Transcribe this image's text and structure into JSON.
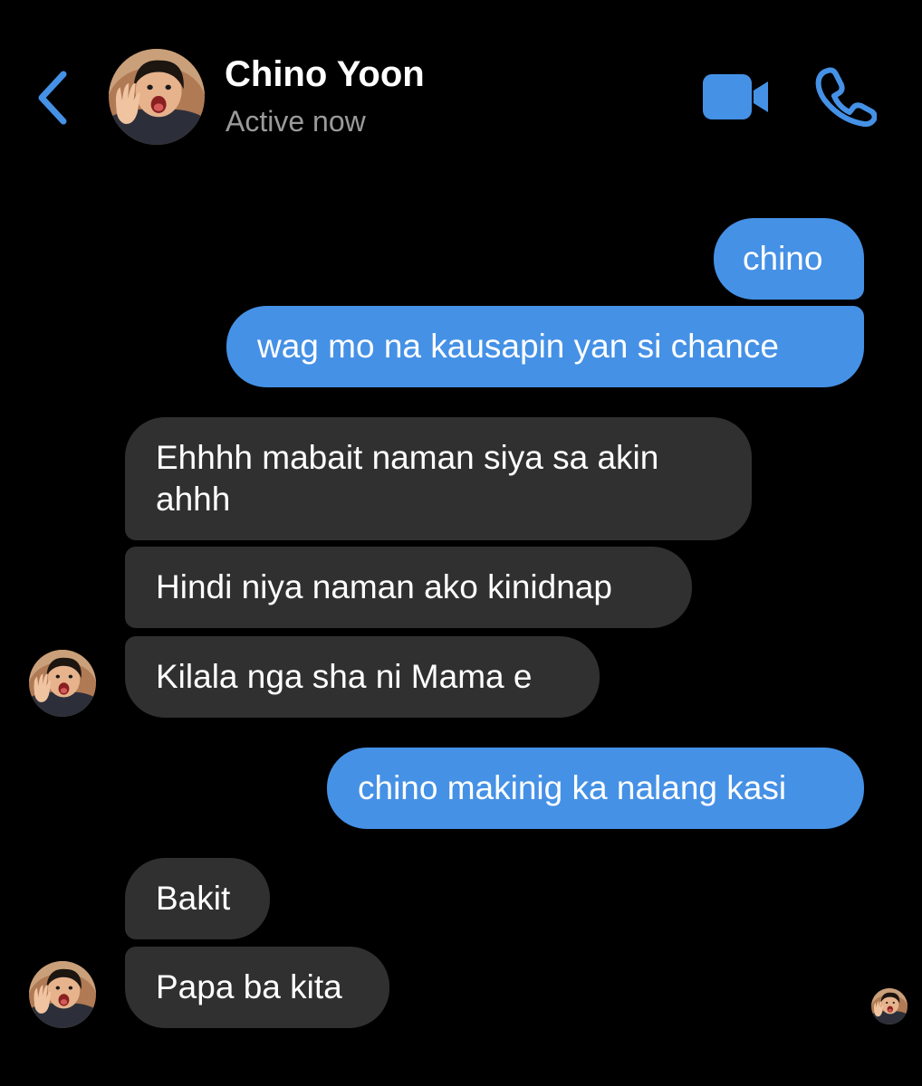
{
  "header": {
    "contact_name": "Chino Yoon",
    "status": "Active now",
    "back_icon": "chevron-left-icon",
    "video_icon": "video-camera-icon",
    "call_icon": "phone-icon",
    "accent_color": "#4591e6"
  },
  "messages": [
    {
      "direction": "outgoing",
      "text": "chino"
    },
    {
      "direction": "outgoing",
      "text": "wag mo na kausapin yan si chance"
    },
    {
      "direction": "incoming",
      "text_line1": "Ehhhh mabait naman siya sa akin",
      "text_line2": "ahhh"
    },
    {
      "direction": "incoming",
      "text": "Hindi niya naman ako kinidnap"
    },
    {
      "direction": "incoming",
      "text": "Kilala nga sha ni Mama e"
    },
    {
      "direction": "outgoing",
      "text": "chino makinig ka nalang kasi"
    },
    {
      "direction": "incoming",
      "text": "Bakit"
    },
    {
      "direction": "incoming",
      "text": "Papa ba kita"
    }
  ],
  "colors": {
    "outgoing_bubble": "#4591e6",
    "incoming_bubble": "#303030",
    "background": "#000000",
    "status_text": "#9a9a9a"
  }
}
